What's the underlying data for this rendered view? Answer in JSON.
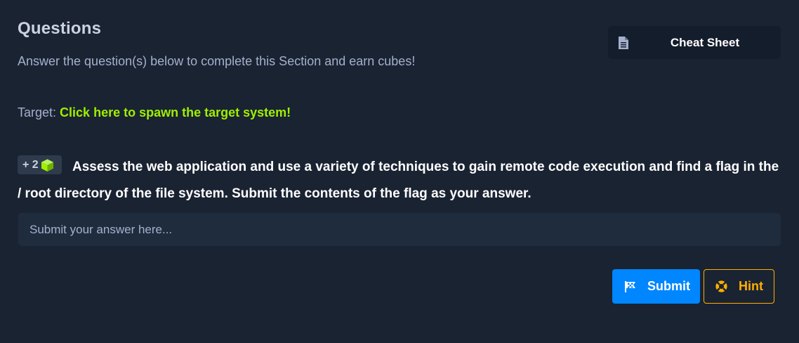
{
  "section": {
    "title": "Questions",
    "subtitle": "Answer the question(s) below to complete this Section and earn cubes!"
  },
  "cheat_sheet": {
    "label": "Cheat Sheet",
    "icon": "document-icon"
  },
  "target": {
    "prefix": "Target:",
    "link_text": "Click here to spawn the target system!"
  },
  "question": {
    "reward_prefix": "+ 2",
    "reward_icon": "cube-icon",
    "text": "Assess the web application and use a variety of techniques to gain remote code execution and find a flag in the / root directory of the file system. Submit the contents of the flag as your answer.",
    "answer_placeholder": "Submit your answer here...",
    "answer_value": ""
  },
  "actions": {
    "submit_label": "Submit",
    "submit_icon": "flag-icon",
    "hint_label": "Hint",
    "hint_icon": "lifebuoy-icon"
  },
  "colors": {
    "background": "#1a2332",
    "accent_green": "#9fef00",
    "submit_blue": "#0086ff",
    "hint_orange": "#ffaf00"
  }
}
